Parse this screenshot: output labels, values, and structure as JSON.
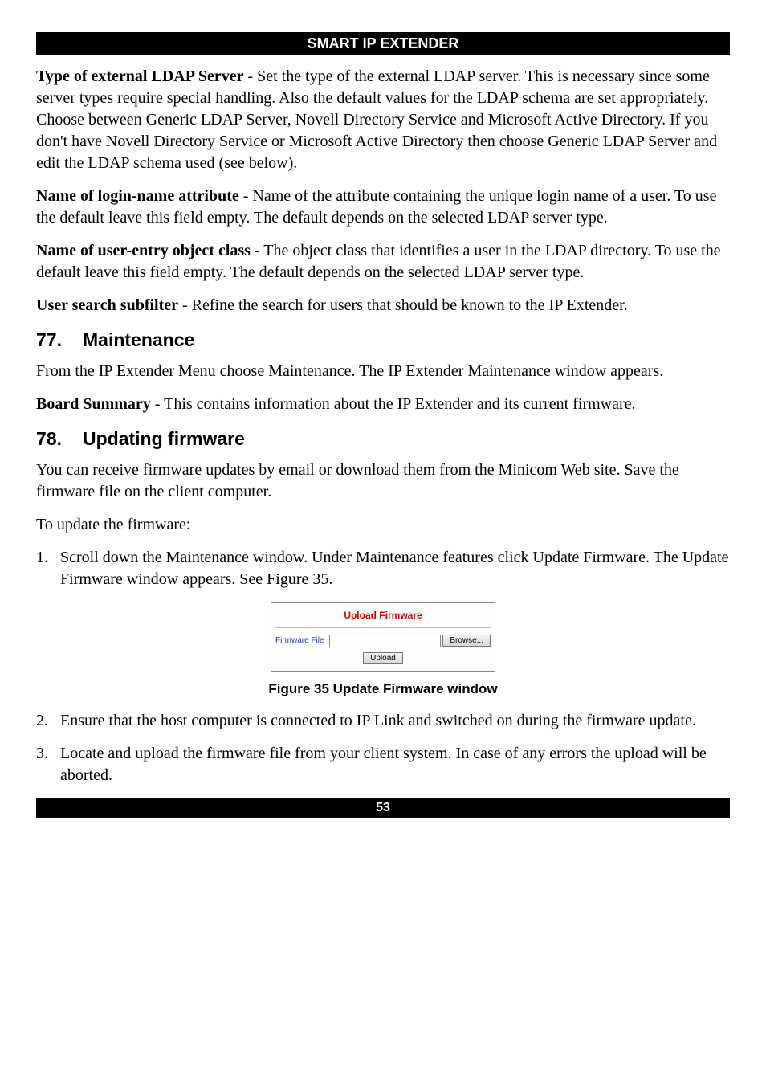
{
  "header": {
    "title": "SMART IP EXTENDER"
  },
  "paragraphs": {
    "p1_bold": "Type of external LDAP Server",
    "p1_rest": " - Set the type of the external LDAP server. This is necessary since some server types require special handling. Also the default values for the LDAP schema are set appropriately. Choose between Generic LDAP Server, Novell Directory Service and Microsoft Active Directory. If you don't have Novell Directory Service or Microsoft Active Directory then choose Generic LDAP Server and edit the LDAP schema used (see below).",
    "p2_bold": "Name of login-name attribute",
    "p2_rest": " - Name of the attribute containing the unique login name of a user. To use the default leave this field empty. The default depends on the selected LDAP server type.",
    "p3_bold": "Name of user-entry object class",
    "p3_rest": " - The object class that identifies a user in the LDAP directory. To use the default leave this field empty. The default depends on the selected LDAP server type.",
    "p4_bold": "User search subfilter",
    "p4_rest": " - Refine the search for users that should be known to the IP Extender."
  },
  "sections": {
    "s77_num": "77.",
    "s77_title": "Maintenance",
    "s77_p1": "From the IP Extender Menu choose Maintenance. The IP Extender Maintenance window appears.",
    "s77_p2_bold": "Board Summary",
    "s77_p2_rest": " - This contains information about the IP Extender and its current firmware.",
    "s78_num": "78.",
    "s78_title": "Updating firmware",
    "s78_p1": "You can receive firmware updates by email or download them from the Minicom Web site. Save the firmware file on the client computer.",
    "s78_p2": "To update the firmware:",
    "s78_li1": "Scroll down the Maintenance window. Under Maintenance features click Update Firmware. The Update Firmware window appears. See Figure 35.",
    "s78_li2": "Ensure that the host computer is connected to IP Link and switched on during the firmware update.",
    "s78_li3": "Locate and upload the firmware file from your client system. In case of any errors the upload will be aborted."
  },
  "figure": {
    "upload_title": "Upload Firmware",
    "file_label": "Firmware File",
    "browse_label": "Browse...",
    "upload_label": "Upload",
    "caption": "Figure 35 Update Firmware window"
  },
  "footer": {
    "page": "53"
  }
}
